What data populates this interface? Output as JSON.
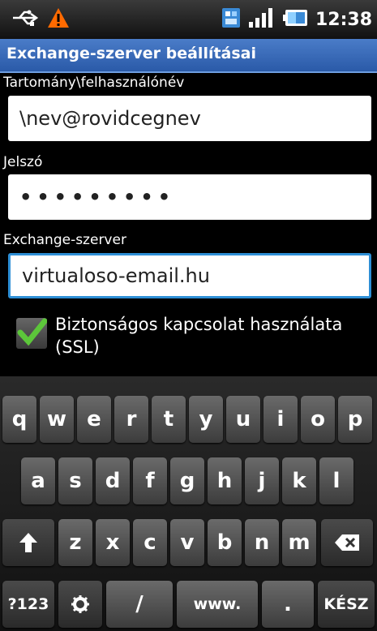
{
  "status_bar": {
    "time": "12:38",
    "icons": [
      "usb-icon",
      "warning-icon",
      "sim-icon",
      "signal-icon",
      "battery-icon"
    ],
    "warning_color": "#ff6a00"
  },
  "title": "Exchange-szerver beállításai",
  "form": {
    "domain_username": {
      "label": "Tartomány\\felhasználónév",
      "value": "\\nev@rovidcegnev"
    },
    "password": {
      "label": "Jelszó",
      "value": "•••••••••"
    },
    "server": {
      "label": "Exchange-szerver",
      "value": "virtualoso-email.hu"
    },
    "ssl": {
      "label": "Biztonságos kapcsolat használata (SSL)",
      "checked": true
    }
  },
  "keyboard": {
    "row1": [
      "q",
      "w",
      "e",
      "r",
      "t",
      "y",
      "u",
      "i",
      "o",
      "p"
    ],
    "row2": [
      "a",
      "s",
      "d",
      "f",
      "g",
      "h",
      "j",
      "k",
      "l"
    ],
    "row3": [
      "z",
      "x",
      "c",
      "v",
      "b",
      "n",
      "m"
    ],
    "row4": {
      "symbols": "?123",
      "slash": "/",
      "www": "www.",
      "dot": ".",
      "done": "KÉSZ"
    },
    "icons": {
      "shift": "shift-icon",
      "backspace": "backspace-icon",
      "settings": "gear-icon"
    }
  },
  "colors": {
    "title_bar": "#2a5aa8",
    "focus_border": "#2e8fd6",
    "check": "#5cc63a"
  }
}
